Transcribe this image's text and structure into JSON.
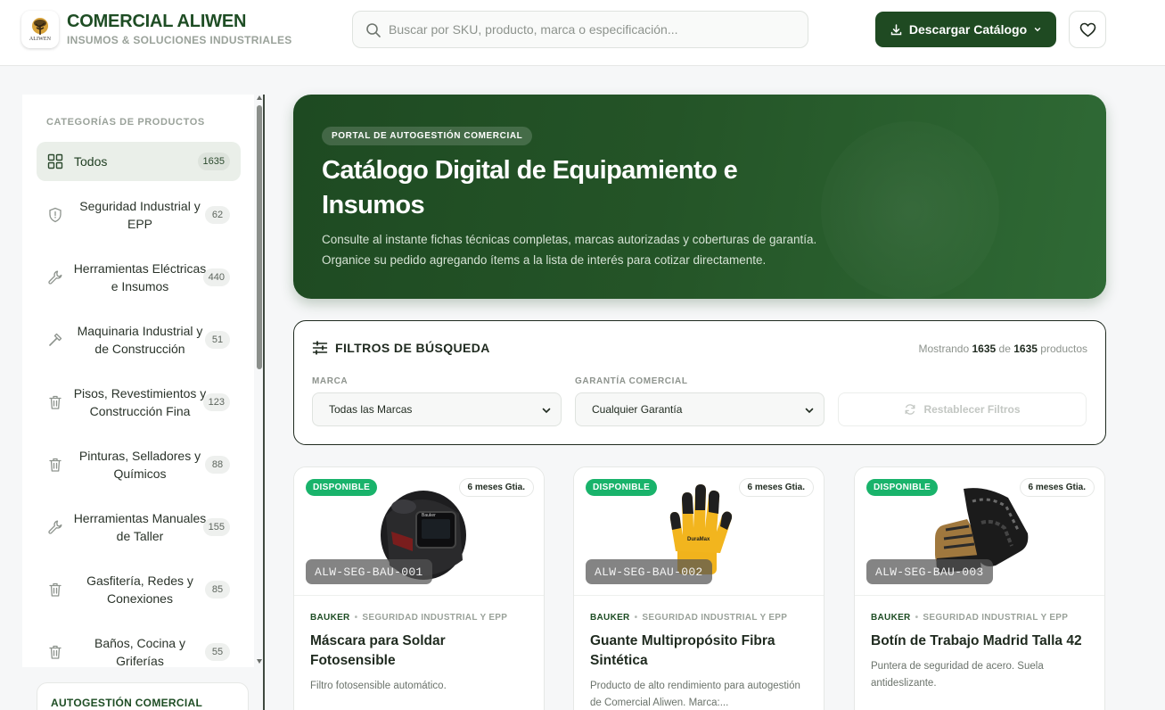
{
  "header": {
    "brand_name": "COMERCIAL ALIWEN",
    "brand_sub": "INSUMOS & SOLUCIONES INDUSTRIALES",
    "logo_text": "ALIWEN",
    "search_placeholder": "Buscar por SKU, producto, marca o especificación...",
    "download_label": "Descargar Catálogo"
  },
  "sidebar": {
    "title": "CATEGORÍAS DE PRODUCTOS",
    "items": [
      {
        "label": "Todos",
        "count": "1635",
        "icon": "grid-icon"
      },
      {
        "label": "Seguridad Industrial y EPP",
        "count": "62",
        "icon": "shield-icon"
      },
      {
        "label": "Herramientas Eléctricas e Insumos",
        "count": "440",
        "icon": "wrench-icon"
      },
      {
        "label": "Maquinaria Industrial y de Construcción",
        "count": "51",
        "icon": "hammer-icon"
      },
      {
        "label": "Pisos, Revestimientos y Construcción Fina",
        "count": "123",
        "icon": "trash-icon"
      },
      {
        "label": "Pinturas, Selladores y Químicos",
        "count": "88",
        "icon": "trash-icon"
      },
      {
        "label": "Herramientas Manuales de Taller",
        "count": "155",
        "icon": "wrench-icon"
      },
      {
        "label": "Gasfitería, Redes y Conexiones",
        "count": "85",
        "icon": "trash-icon"
      },
      {
        "label": "Baños, Cocina y Griferías",
        "count": "55",
        "icon": "trash-icon"
      }
    ],
    "auto_title": "AUTOGESTIÓN COMERCIAL"
  },
  "hero": {
    "badge": "PORTAL DE AUTOGESTIÓN COMERCIAL",
    "title": "Catálogo Digital de Equipamiento e Insumos",
    "desc_line1": "Consulte al instante fichas técnicas completas, marcas autorizadas y coberturas de garantía.",
    "desc_line2": "Organice su pedido agregando ítems a la lista de interés para cotizar directamente."
  },
  "filters": {
    "title": "FILTROS DE BÚSQUEDA",
    "count_prefix": "Mostrando",
    "count_shown": "1635",
    "count_mid": "de",
    "count_total": "1635",
    "count_suffix": "productos",
    "brand_label": "MARCA",
    "brand_value": "Todas las Marcas",
    "warranty_label": "GARANTÍA COMERCIAL",
    "warranty_value": "Cualquier Garantía",
    "reset_label": "Restablecer Filtros"
  },
  "products": [
    {
      "status": "DISPONIBLE",
      "warranty": "6 meses Gtia.",
      "sku": "ALW-SEG-BAU-001",
      "brand": "BAUKER",
      "category": "SEGURIDAD INDUSTRIAL Y EPP",
      "name": "Máscara para Soldar Fotosensible",
      "desc": "Filtro fotosensible automático."
    },
    {
      "status": "DISPONIBLE",
      "warranty": "6 meses Gtia.",
      "sku": "ALW-SEG-BAU-002",
      "brand": "BAUKER",
      "category": "SEGURIDAD INDUSTRIAL Y EPP",
      "name": "Guante Multipropósito Fibra Sintética",
      "desc": "Producto de alto rendimiento para autogestión de Comercial Aliwen. Marca:..."
    },
    {
      "status": "DISPONIBLE",
      "warranty": "6 meses Gtia.",
      "sku": "ALW-SEG-BAU-003",
      "brand": "BAUKER",
      "category": "SEGURIDAD INDUSTRIAL Y EPP",
      "name": "Botín de Trabajo Madrid Talla 42",
      "desc": "Puntera de seguridad de acero. Suela antideslizante."
    }
  ],
  "colors": {
    "brand_green": "#1e4d24",
    "accent_green": "#19b36b",
    "hero_start": "#1e4a22",
    "hero_end": "#2f6a35"
  }
}
